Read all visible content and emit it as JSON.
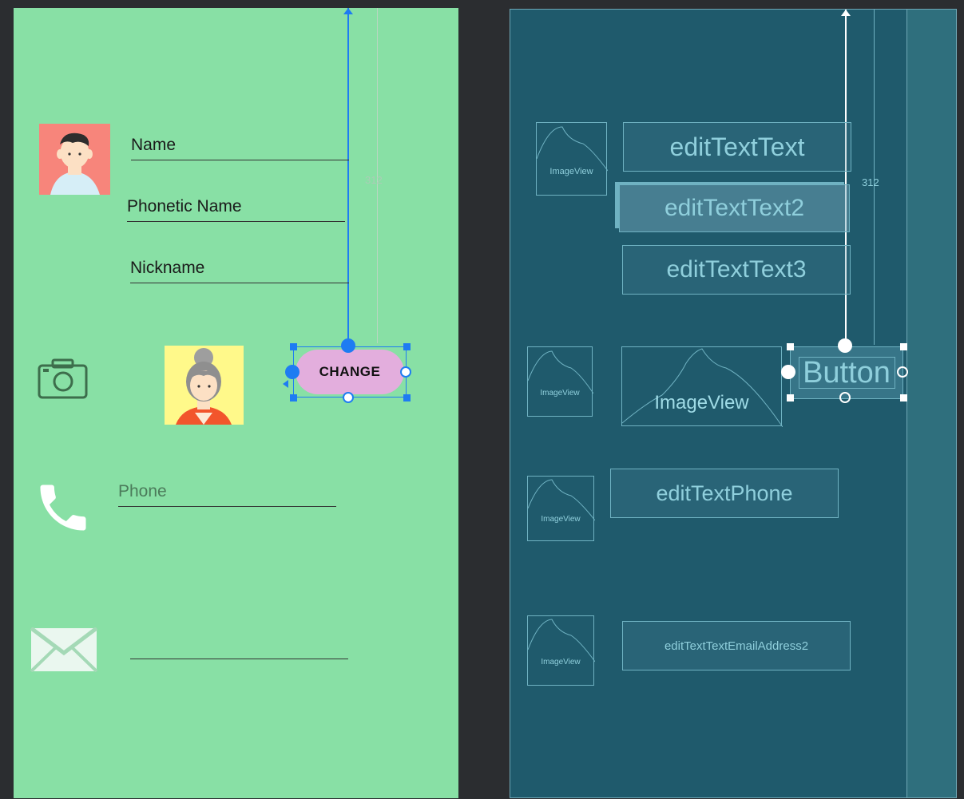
{
  "design": {
    "fields": {
      "name": "Name",
      "phonetic_name": "Phonetic Name",
      "nickname": "Nickname",
      "phone_hint": "Phone"
    },
    "change_button": "CHANGE",
    "constraint_value": "312"
  },
  "blueprint": {
    "image_view_label": "ImageView",
    "edit_text_1": "editTextText",
    "edit_text_2": "editTextText2",
    "edit_text_3": "editTextText3",
    "button_label": "Button",
    "edit_text_phone": "editTextPhone",
    "edit_text_email": "editTextTextEmailAddress2",
    "constraint_value": "312"
  },
  "icons": [
    "male-avatar-icon",
    "camera-icon",
    "female-avatar-icon",
    "phone-icon",
    "mail-icon"
  ],
  "colors": {
    "design_background": "#88e0a5",
    "blueprint_background": "#1f5a6c",
    "selection": "#1e7cf2",
    "change_button": "#e3aedd"
  }
}
